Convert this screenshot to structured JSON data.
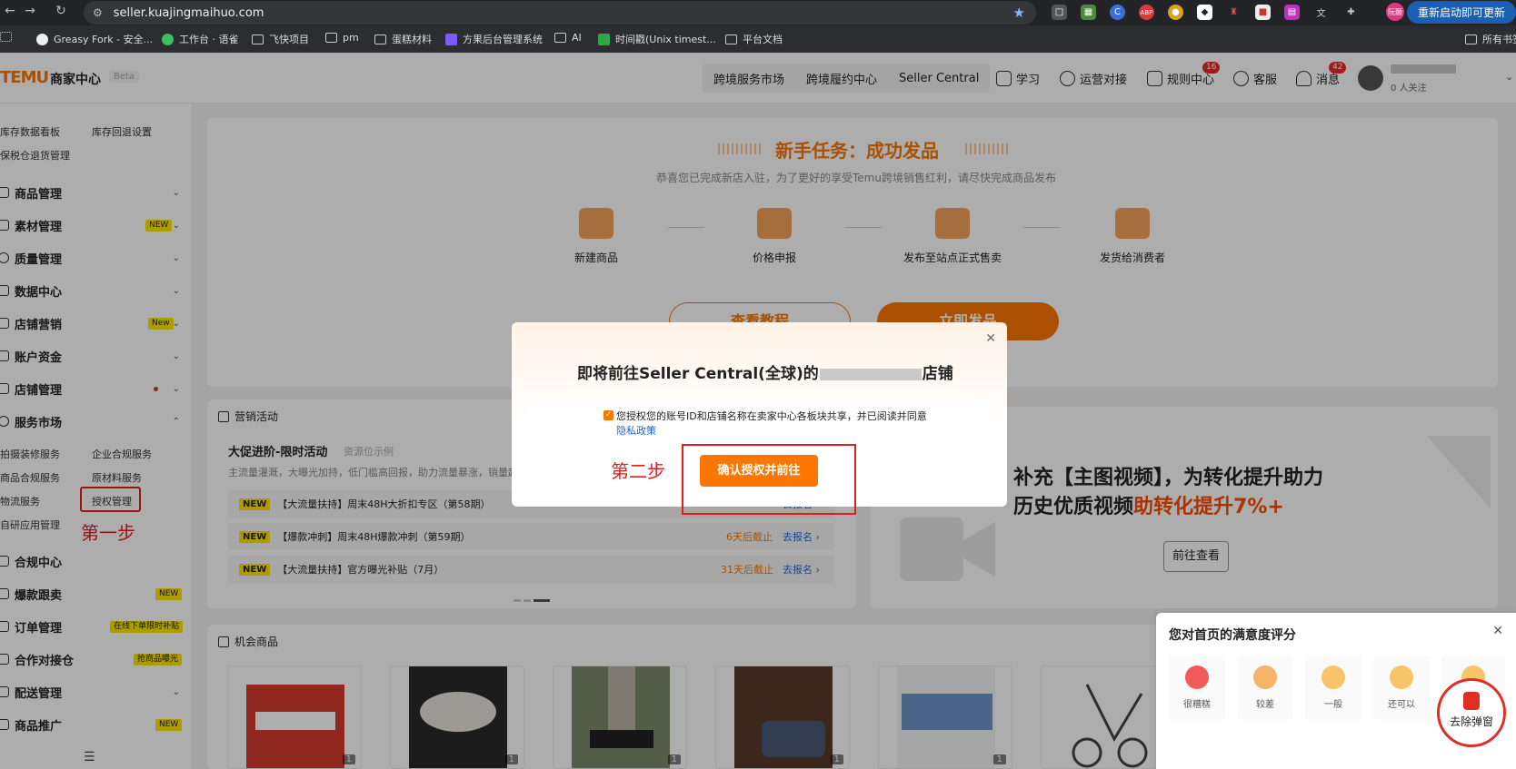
{
  "browser": {
    "url": "seller.kuajingmaihuo.com",
    "restart_label": "重新启动即可更新",
    "profile_label": "阮颢",
    "bookmarks": [
      "Greasy Fork - 安全...",
      "工作台 · 语雀",
      "飞快项目",
      "pm",
      "蛋糕材料",
      "方果后台管理系统",
      "AI",
      "时间戳(Unix timest...",
      "平台文档",
      "所有书签"
    ],
    "extensions": [
      "abp-icon",
      "chrome-icon",
      "translate-icon",
      "puzzle-icon"
    ]
  },
  "header": {
    "logo": "TEMU",
    "logo_sub": "商家中心",
    "beta": "Beta",
    "tabs": [
      "跨境服务市场",
      "跨境履约中心",
      "Seller Central"
    ],
    "items": [
      {
        "label": "学习",
        "icon": "book-icon"
      },
      {
        "label": "运营对接",
        "icon": "chat-icon"
      },
      {
        "label": "规则中心",
        "icon": "rules-icon",
        "badge": "16"
      },
      {
        "label": "客服",
        "icon": "headset-icon"
      },
      {
        "label": "消息",
        "icon": "bell-icon",
        "badge": "42"
      }
    ],
    "followers": "0 人关注"
  },
  "sidebar": {
    "top_subs": [
      "库存数据看板",
      "库存回退设置",
      "保税仓退货管理"
    ],
    "menus": [
      {
        "label": "商品管理"
      },
      {
        "label": "素材管理",
        "tag": "NEW"
      },
      {
        "label": "质量管理"
      },
      {
        "label": "数据中心"
      },
      {
        "label": "店铺营销",
        "tag": "New"
      },
      {
        "label": "账户资金"
      },
      {
        "label": "店铺管理"
      },
      {
        "label": "服务市场"
      }
    ],
    "service_subs": [
      "拍摄装修服务",
      "企业合规服务",
      "商品合规服务",
      "原材料服务",
      "物流服务",
      "授权管理",
      "自研应用管理"
    ],
    "menus2": [
      {
        "label": "合规中心"
      },
      {
        "label": "爆款跟卖",
        "tag": "NEW"
      },
      {
        "label": "订单管理",
        "tag": "在线下单限时补贴"
      },
      {
        "label": "合作对接仓",
        "tag": "抢商品曝光"
      },
      {
        "label": "配送管理"
      },
      {
        "label": "商品推广",
        "tag": "NEW"
      }
    ],
    "step1": "第一步"
  },
  "task": {
    "title": "新手任务：成功发品",
    "subtitle": "恭喜您已完成新店入驻，为了更好的享受Temu跨境销售红利，请尽快完成商品发布",
    "steps": [
      "新建商品",
      "价格申报",
      "发布至站点正式售卖",
      "发货给消费者"
    ],
    "btn_tutorial": "查看教程",
    "btn_publish": "立即发品"
  },
  "promo": {
    "section": "营销活动",
    "head": "大促进阶-限时活动",
    "head_sub": "资源位示例",
    "desc": "主流量灌溉，大曝光加持，低门槛高回报，助力流量暴涨，销量起",
    "rows": [
      {
        "tag": "NEW",
        "text": "【大流量扶持】周末48H大折扣专区（第58期）",
        "deadline": "",
        "go": "去报名 ›"
      },
      {
        "tag": "NEW",
        "text": "【爆款冲刺】周末48H爆款冲刺（第59期）",
        "deadline": "6天后截止",
        "go": "去报名 ›"
      },
      {
        "tag": "NEW",
        "text": "【大流量扶持】官方曝光补贴（7月）",
        "deadline": "31天后截止",
        "go": "去报名 ›"
      }
    ]
  },
  "video": {
    "line1": "补充【主图视频】，为转化提升助力",
    "line2_pre": "历史优质视频",
    "line2_hl": "助转化提升7%+",
    "btn": "前往查看"
  },
  "products": {
    "section": "机会商品",
    "items": [
      {
        "count": "1",
        "color": "#d43a2f"
      },
      {
        "count": "1",
        "color": "#3a3a3a"
      },
      {
        "count": "1",
        "color": "#8a8a7a"
      },
      {
        "count": "1",
        "color": "#5a3a2a"
      },
      {
        "count": "1",
        "color": "#6f95c9"
      },
      {
        "count": "1",
        "color": "#444444"
      }
    ]
  },
  "survey": {
    "title": "您对首页的满意度评分",
    "faces": [
      {
        "label": "很糟糕",
        "color": "#f05a5a"
      },
      {
        "label": "较差",
        "color": "#f7b36a"
      },
      {
        "label": "一般",
        "color": "#f7c46a"
      },
      {
        "label": "还可以",
        "color": "#f7c46a"
      }
    ],
    "remove_label": "去除弹窗"
  },
  "modal": {
    "title_pre": "即将前往Seller Central(全球)的",
    "title_post": "店铺",
    "consent": "您授权您的账号ID和店铺名称在卖家中心各板块共享，并已阅读并同意",
    "privacy": "隐私政策",
    "confirm": "确认授权并前往",
    "step2": "第二步"
  }
}
